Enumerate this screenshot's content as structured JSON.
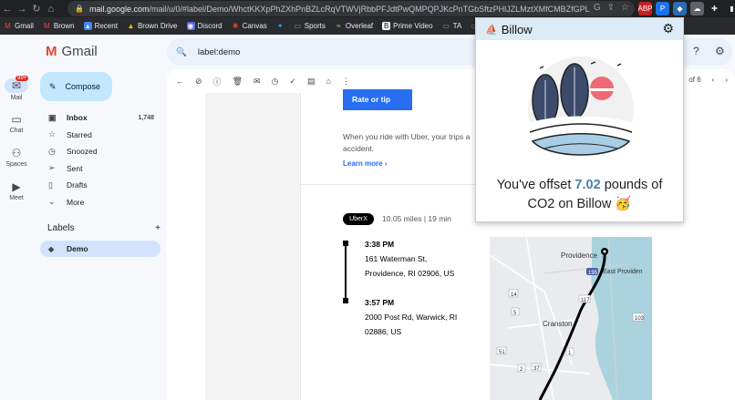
{
  "browser": {
    "url_host": "mail.google.com",
    "url_path": "/mail/u/0/#label/Demo/WhctKKXpPhZXhPnBZLcRqVTWVjRbbPFJdtPwQMPQPJKcPnTGbSftzPHlJZLMztXMfCMBZfGPL",
    "bookmarks": [
      "Gmail",
      "Brown",
      "Recent",
      "Brown Drive",
      "Discord",
      "Canvas",
      "Sports",
      "Overleaf",
      "Prime Video",
      "TA",
      "Ch"
    ]
  },
  "gmail": {
    "app_name": "Gmail",
    "search_query": "label:demo",
    "rail": [
      {
        "label": "Mail",
        "badge": "99+"
      },
      {
        "label": "Chat"
      },
      {
        "label": "Spaces"
      },
      {
        "label": "Meet"
      }
    ],
    "compose_label": "Compose",
    "folders": [
      {
        "label": "Inbox",
        "count": "1,748"
      },
      {
        "label": "Starred"
      },
      {
        "label": "Snoozed"
      },
      {
        "label": "Sent"
      },
      {
        "label": "Drafts"
      },
      {
        "label": "More"
      }
    ],
    "labels_heading": "Labels",
    "labels": [
      "Demo"
    ],
    "pager_text": "of 6"
  },
  "email": {
    "rate_button": "Rate or tip",
    "body_text": "When you ride with Uber, your trips a accident.",
    "learn_more": "Learn more",
    "ride_type": "UberX",
    "ride_info": "10.05 miles | 19 min",
    "stops": [
      {
        "time": "3:38 PM",
        "line1": "161 Waterman St,",
        "line2": "Providence, RI 02906, US"
      },
      {
        "time": "3:57 PM",
        "line1": "2000 Post Rd, Warwick, RI",
        "line2": "02886, US"
      }
    ],
    "map_labels": [
      "Providence",
      "East Providen",
      "Cranston",
      "195",
      "117",
      "103",
      "14",
      "5",
      "1",
      "51",
      "2",
      "37"
    ]
  },
  "billow": {
    "title": "Billow",
    "offset_prefix": "You've offset",
    "offset_value": "7.02",
    "offset_suffix": "pounds of",
    "offset_line2": "CO2 on Billow",
    "emoji": "🥳",
    "colors": {
      "accent": "#4f7ea3",
      "leaf": "#3d4b6b",
      "sun": "#ee6b76",
      "header": "#dcebf5"
    }
  }
}
